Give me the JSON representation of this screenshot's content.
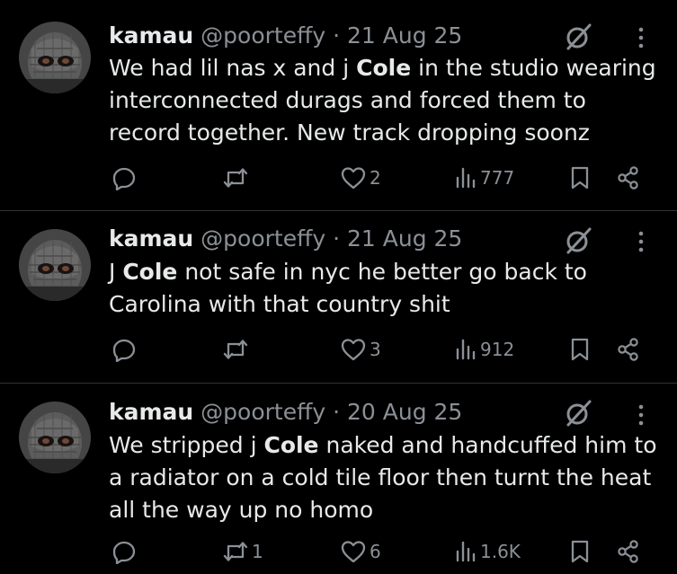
{
  "tweets": [
    {
      "name": "kamau",
      "handle": "@poorteffy",
      "separator": "·",
      "date": "21 Aug 25",
      "text_parts": [
        "We had lil nas x and j ",
        "Cole",
        " in the studio wearing interconnected durags and forced them to record together. New track dropping soonz"
      ],
      "replies": "",
      "reposts": "",
      "likes": "2",
      "views": "777"
    },
    {
      "name": "kamau",
      "handle": "@poorteffy",
      "separator": "·",
      "date": "21 Aug 25",
      "text_parts": [
        "J ",
        "Cole",
        " not safe in nyc he better go back to Carolina with that country shit"
      ],
      "replies": "",
      "reposts": "",
      "likes": "3",
      "views": "912"
    },
    {
      "name": "kamau",
      "handle": "@poorteffy",
      "separator": "·",
      "date": "20 Aug 25",
      "text_parts": [
        "We stripped j ",
        "Cole",
        " naked and handcuffed him to a radiator on a cold tile floor then turnt the heat all the way up no homo"
      ],
      "replies": "",
      "reposts": "1",
      "likes": "6",
      "views": "1.6K"
    }
  ],
  "colors": {
    "background": "#000000",
    "text": "#e7e9ea",
    "secondary": "#8b9096",
    "divider": "#2f3336"
  },
  "icons": [
    "avatar-balaclava",
    "grok-icon",
    "more-icon",
    "reply-icon",
    "repost-icon",
    "like-icon",
    "views-icon",
    "bookmark-icon",
    "share-icon"
  ]
}
